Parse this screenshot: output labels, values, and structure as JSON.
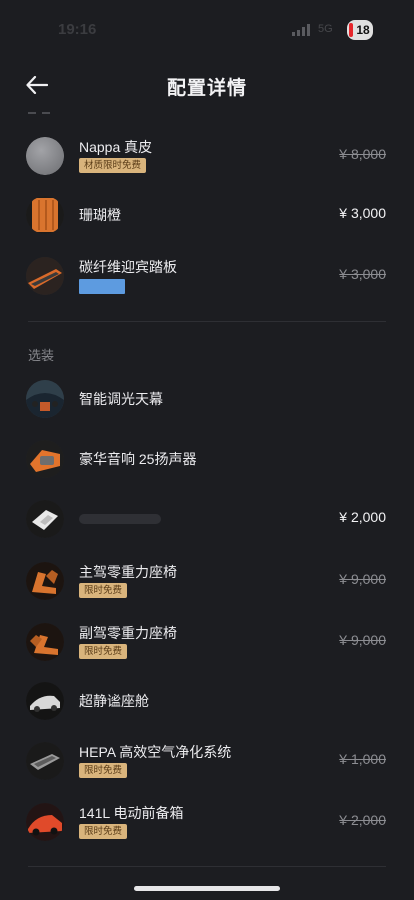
{
  "status_bar": {
    "time": "19:16",
    "network": "5G",
    "battery": "18"
  },
  "nav": {
    "title": "配置详情"
  },
  "items_upper": [
    {
      "name": "Nappa 真皮",
      "badge": "材质限时免费",
      "price": "¥ 8,000",
      "strike": true
    },
    {
      "name": "珊瑚橙",
      "price": "¥ 3,000",
      "strike": false
    },
    {
      "name": "碳纤维迎宾踏板",
      "price": "¥ 3,000",
      "strike": true
    }
  ],
  "section_optional": {
    "title": "选装"
  },
  "items_optional": [
    {
      "name": "智能调光天幕"
    },
    {
      "name": "豪华音响 25扬声器"
    },
    {
      "price": "¥ 2,000"
    },
    {
      "name": "主驾零重力座椅",
      "badge": "限时免费",
      "price": "¥ 9,000"
    },
    {
      "name": "副驾零重力座椅",
      "badge": "限时免费",
      "price": "¥ 9,000"
    },
    {
      "name": "超静谧座舱"
    },
    {
      "name": "HEPA 高效空气净化系统",
      "badge": "限时免费",
      "price": "¥ 1,000"
    },
    {
      "name": "141L 电动前备箱",
      "badge": "限时免费",
      "price": "¥ 2,000"
    }
  ],
  "colors": {
    "background": "#1c1d21",
    "badge": "#d9b47c",
    "accent_orange": "#e2742c"
  },
  "icons": {
    "back": "arrow-left-icon"
  }
}
